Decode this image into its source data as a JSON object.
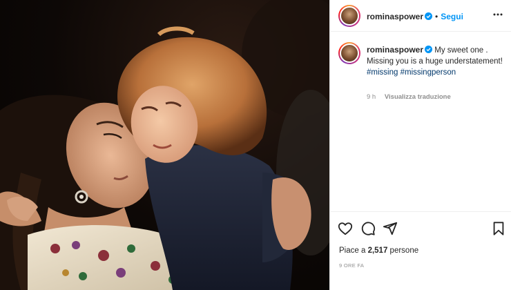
{
  "post": {
    "username": "rominaspower",
    "follow_label": "Segui",
    "separator": "•",
    "caption": {
      "username": "rominaspower",
      "text": "My sweet one . Missing you is a huge understatement!",
      "hashtags": [
        "#missing",
        "#missingperson"
      ]
    },
    "time_short": "9 h",
    "translate_label": "Visualizza traduzione",
    "likes_prefix": "Piace a",
    "likes_count": "2,517",
    "likes_suffix": "persone",
    "time_ago": "9 ORE FA"
  },
  "icons": {
    "verified": "verified-badge-icon",
    "more": "more-options-icon",
    "like": "heart-icon",
    "comment": "comment-icon",
    "share": "share-icon",
    "save": "bookmark-icon"
  },
  "colors": {
    "accent": "#0095f6",
    "hashtag": "#00376b",
    "secondary_text": "#8e8e8e",
    "border": "#efefef"
  }
}
